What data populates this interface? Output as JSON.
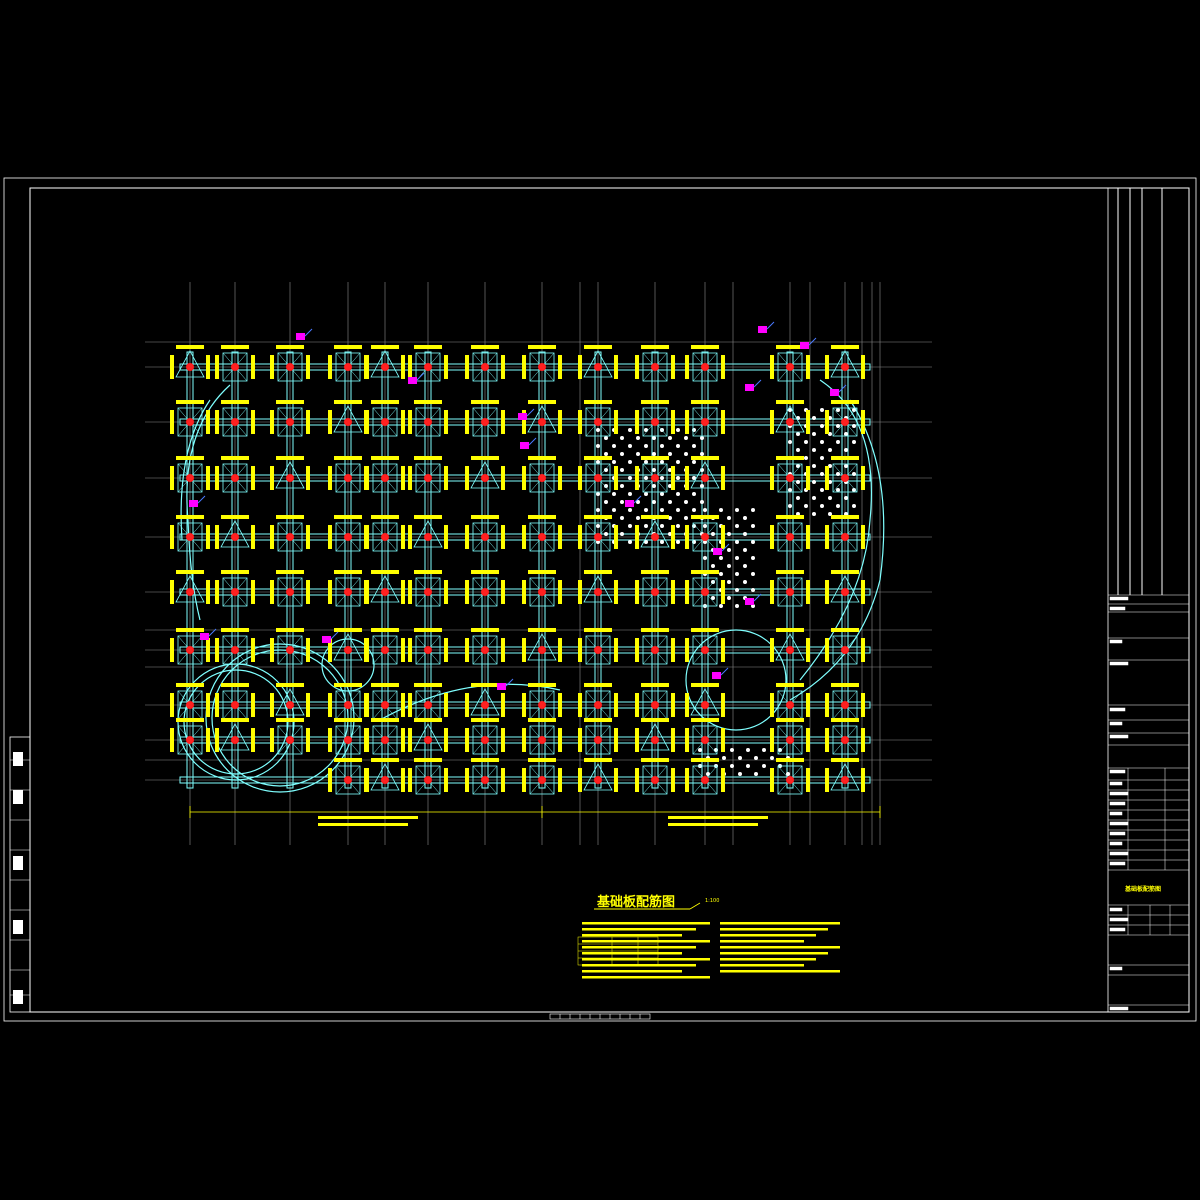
{
  "drawing": {
    "title": "基础板配筋图",
    "scale": "1:100"
  },
  "title_block": {
    "drawing_name": "基础板配筋图"
  },
  "colors": {
    "background": "#000000",
    "border": "#ffffff",
    "grid": "#8c8c8c",
    "beam": "#7fffff",
    "rebar": "#ffff00",
    "pile": "#ff2020",
    "tag": "#ff00ff",
    "annotation": "#ffff00"
  }
}
